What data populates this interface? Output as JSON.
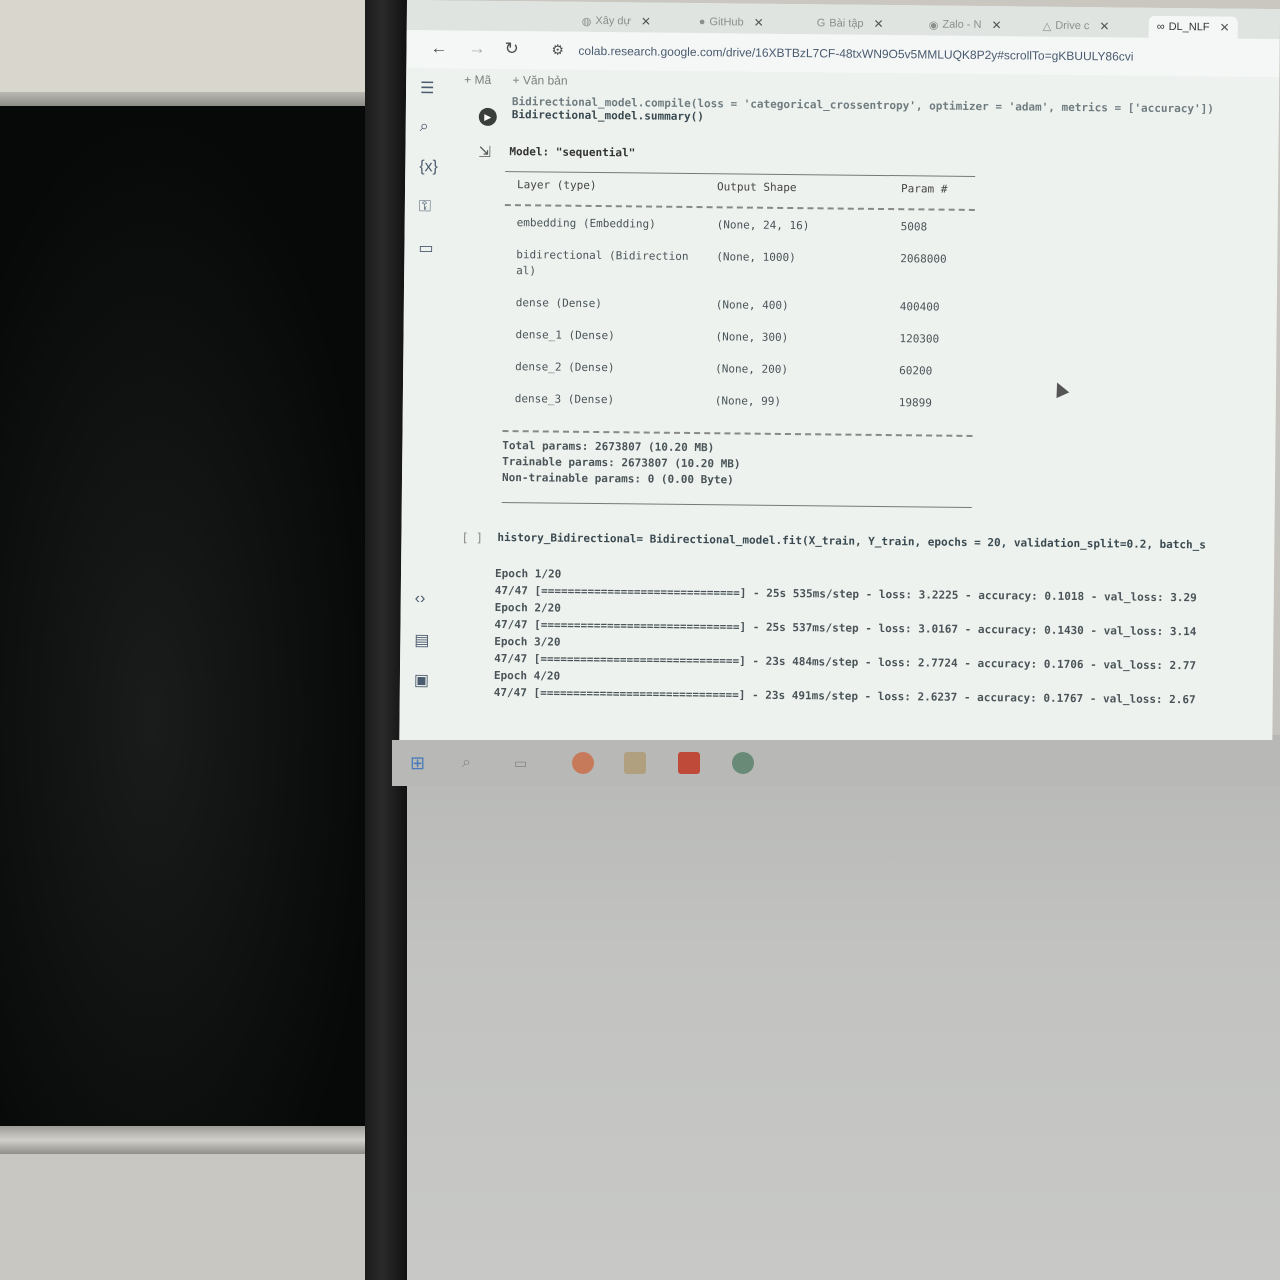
{
  "browser": {
    "tabs": [
      {
        "label": "Xây dự",
        "icon": "globe-icon"
      },
      {
        "label": "GitHub",
        "icon": "github-icon"
      },
      {
        "label": "Bài tập",
        "icon": "google-icon"
      },
      {
        "label": "Zalo - N",
        "icon": "zalo-icon"
      },
      {
        "label": "Drive c",
        "icon": "drive-icon"
      },
      {
        "label": "DL_NLF",
        "icon": "colab-icon"
      }
    ],
    "url": "colab.research.google.com/drive/16XBTBzL7CF-48txWN9O5v5MMLUQK8P2y#scrollTo=gKBUULY86cvi"
  },
  "colab": {
    "toolbar": [
      "+ Mã",
      "+ Văn bản"
    ],
    "code_lines": [
      "Bidirectional_model.compile(loss = 'categorical_crossentropy', optimizer = 'adam', metrics = ['accuracy'])",
      "Bidirectional_model.summary()"
    ],
    "summary": {
      "model_line": "Model: \"sequential\"",
      "headers": [
        "Layer (type)",
        "Output Shape",
        "Param #"
      ],
      "rows": [
        {
          "layer": "embedding (Embedding)",
          "shape": "(None, 24, 16)",
          "params": "5008"
        },
        {
          "layer": "bidirectional (Bidirection",
          "layer2": "al)",
          "shape": "(None, 1000)",
          "params": "2068000"
        },
        {
          "layer": "dense (Dense)",
          "shape": "(None, 400)",
          "params": "400400"
        },
        {
          "layer": "dense_1 (Dense)",
          "shape": "(None, 300)",
          "params": "120300"
        },
        {
          "layer": "dense_2 (Dense)",
          "shape": "(None, 200)",
          "params": "60200"
        },
        {
          "layer": "dense_3 (Dense)",
          "shape": "(None, 99)",
          "params": "19899"
        }
      ],
      "total": "Total params: 2673807 (10.20 MB)",
      "trainable": "Trainable params: 2673807 (10.20 MB)",
      "non_trainable": "Non-trainable params: 0 (0.00 Byte)"
    },
    "fit_cell": {
      "bracket": "[ ]",
      "code": "history_Bidirectional= Bidirectional_model.fit(X_train, Y_train, epochs = 20, validation_split=0.2, batch_s",
      "log": [
        "Epoch 1/20",
        "47/47 [==============================] - 25s 535ms/step - loss: 3.2225 - accuracy: 0.1018 - val_loss: 3.29",
        "Epoch 2/20",
        "47/47 [==============================] - 25s 537ms/step - loss: 3.0167 - accuracy: 0.1430 - val_loss: 3.14",
        "Epoch 3/20",
        "47/47 [==============================] - 23s 484ms/step - loss: 2.7724 - accuracy: 0.1706 - val_loss: 2.77",
        "Epoch 4/20",
        "47/47 [==============================] - 23s 491ms/step - loss: 2.6237 - accuracy: 0.1767 - val_loss: 2.67"
      ]
    }
  }
}
